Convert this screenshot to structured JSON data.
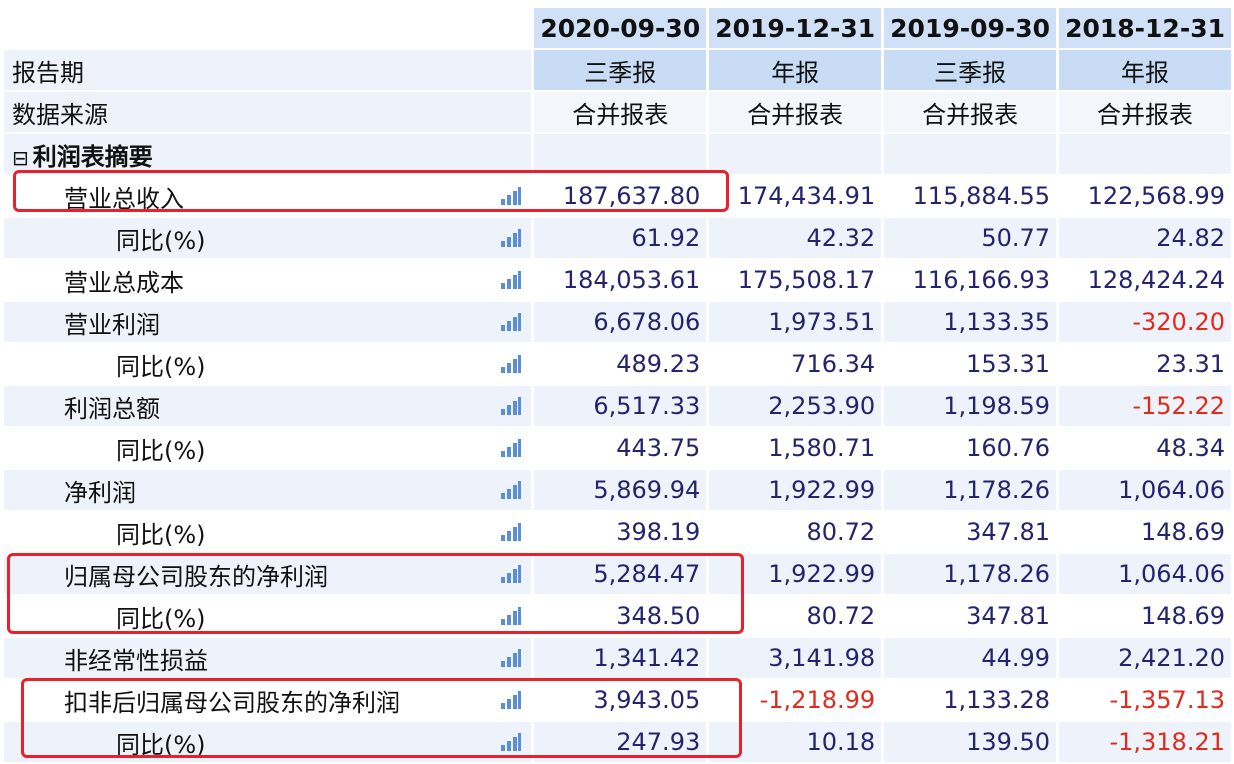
{
  "periods": [
    {
      "date": "2020-09-30",
      "type": "三季报",
      "source": "合并报表"
    },
    {
      "date": "2019-12-31",
      "type": "年报",
      "source": "合并报表"
    },
    {
      "date": "2019-09-30",
      "type": "三季报",
      "source": "合并报表"
    },
    {
      "date": "2018-12-31",
      "type": "年报",
      "source": "合并报表"
    }
  ],
  "labels": {
    "report_period": "报告期",
    "data_source": "数据来源"
  },
  "section": {
    "toggle": "⊟",
    "title": "利润表摘要"
  },
  "rows": [
    {
      "label": "营业总收入",
      "values": [
        "187,637.80",
        "174,434.91",
        "115,884.55",
        "122,568.99"
      ]
    },
    {
      "label": "同比(%)",
      "values": [
        "61.92",
        "42.32",
        "50.77",
        "24.82"
      ]
    },
    {
      "label": "营业总成本",
      "values": [
        "184,053.61",
        "175,508.17",
        "116,166.93",
        "128,424.24"
      ]
    },
    {
      "label": "营业利润",
      "values": [
        "6,678.06",
        "1,973.51",
        "1,133.35",
        "-320.20"
      ]
    },
    {
      "label": "同比(%)",
      "values": [
        "489.23",
        "716.34",
        "153.31",
        "23.31"
      ]
    },
    {
      "label": "利润总额",
      "values": [
        "6,517.33",
        "2,253.90",
        "1,198.59",
        "-152.22"
      ]
    },
    {
      "label": "同比(%)",
      "values": [
        "443.75",
        "1,580.71",
        "160.76",
        "48.34"
      ]
    },
    {
      "label": "净利润",
      "values": [
        "5,869.94",
        "1,922.99",
        "1,178.26",
        "1,064.06"
      ]
    },
    {
      "label": "同比(%)",
      "values": [
        "398.19",
        "80.72",
        "347.81",
        "148.69"
      ]
    },
    {
      "label": "归属母公司股东的净利润",
      "values": [
        "5,284.47",
        "1,922.99",
        "1,178.26",
        "1,064.06"
      ]
    },
    {
      "label": "同比(%)",
      "values": [
        "348.50",
        "80.72",
        "347.81",
        "148.69"
      ]
    },
    {
      "label": "非经常性损益",
      "values": [
        "1,341.42",
        "3,141.98",
        "44.99",
        "2,421.20"
      ]
    },
    {
      "label": "扣非后归属母公司股东的净利润",
      "values": [
        "3,943.05",
        "-1,218.99",
        "1,133.28",
        "-1,357.13"
      ]
    },
    {
      "label": "同比(%)",
      "values": [
        "247.93",
        "10.18",
        "139.50",
        "-1,318.21"
      ]
    }
  ],
  "colors": {
    "negative": "#e02a1e",
    "value": "#23236e",
    "highlight": "#e8212a",
    "header_bg": "#cfe0f7"
  },
  "icons": {
    "row_chart": "bar-chart-icon"
  }
}
